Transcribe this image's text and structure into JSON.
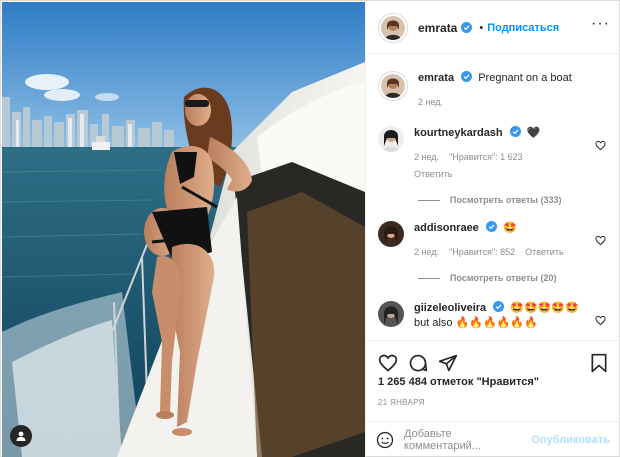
{
  "post": {
    "username": "emrata",
    "follow_label": "Подписаться",
    "caption_text": "Pregnant on a boat",
    "caption_time": "2 нед.",
    "likes_text": "1 265 484 отметок \"Нравится\"",
    "date_text": "21 ЯНВАРЯ"
  },
  "comments": [
    {
      "user": "kourtneykardash",
      "text": "🖤",
      "time": "2 нед.",
      "likes": "\"Нравится\": 1 623",
      "reply_label": "Ответить",
      "replies_label": "Посмотреть ответы (333)"
    },
    {
      "user": "addisonraee",
      "text": "🤩",
      "time": "2 нед.",
      "likes": "\"Нравится\": 852",
      "reply_label": "Ответить",
      "replies_label": "Посмотреть ответы (20)"
    },
    {
      "user": "giizeleoliveira",
      "text": "🤩🤩🤩🤩🤩",
      "text2": "but also 🔥🔥🔥🔥🔥🔥"
    }
  ],
  "composer": {
    "placeholder": "Добавьте комментарий...",
    "publish_label": "Опубликовать"
  },
  "icons": {
    "verified": "verified-badge-icon",
    "more": "more-options-icon",
    "heart": "heart-icon",
    "comment": "comment-icon",
    "share": "share-icon",
    "save": "bookmark-icon",
    "emoji": "emoji-icon",
    "tag": "user-tag-icon"
  },
  "colors": {
    "link_blue": "#0095f6",
    "verified_blue": "#3897f0",
    "muted": "#8e8e8e",
    "publish_disabled": "#b2dffc"
  }
}
